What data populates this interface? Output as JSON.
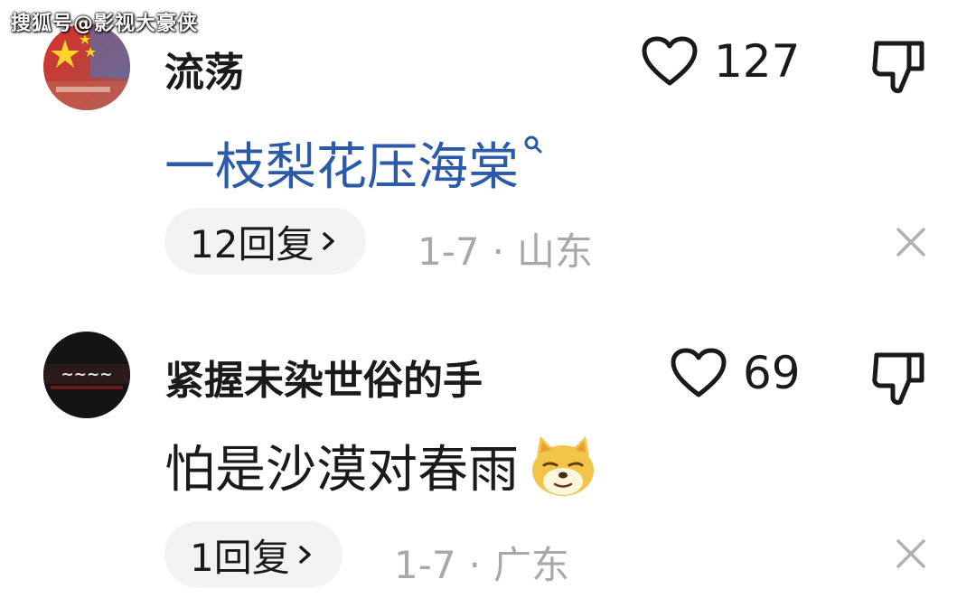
{
  "watermark": "搜狐号@影视大豪侠",
  "comments": [
    {
      "username": "流荡",
      "likes": "127",
      "text": "一枝梨花压海棠",
      "text_color": "#2a5aa8",
      "has_search_link": true,
      "replies": "12回复",
      "date": "1-7",
      "location": "山东",
      "avatar_icon": "flag-avatar-icon"
    },
    {
      "username": "紧握未染世俗的手",
      "likes": "69",
      "text": "怕是沙漠对春雨",
      "text_color": "#1a1a1a",
      "emoji": "doge-emoji-icon",
      "replies": "1回复",
      "date": "1-7",
      "location": "广东",
      "avatar_icon": "dark-logo-avatar-icon"
    }
  ],
  "colors": {
    "link_blue": "#2a5aa8",
    "meta_gray": "#a8a8a8",
    "pill_bg": "#f3f3f3"
  }
}
